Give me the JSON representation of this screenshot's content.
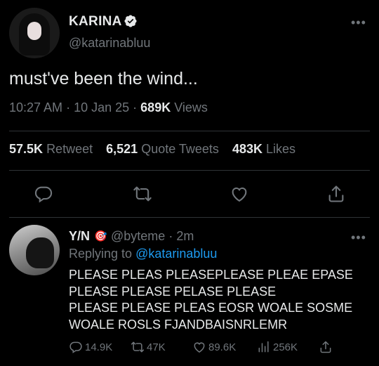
{
  "tweet": {
    "display_name": "KARINA",
    "handle": "@katarinabluu",
    "text": "must've been the wind...",
    "time": "10:27 AM",
    "date": "10 Jan 25",
    "views_count": "689K",
    "views_label": "Views",
    "retweets_count": "57.5K",
    "retweets_label": "Retweet",
    "quotes_count": "6,521",
    "quotes_label": "Quote Tweets",
    "likes_count": "483K",
    "likes_label": "Likes"
  },
  "reply": {
    "display_name": "Y/N",
    "emoji": "🎯",
    "handle": "@byteme",
    "time": "2m",
    "replying_prefix": "Replying to",
    "replying_handle": "@katarinabluu",
    "lines": [
      "PLEASE PLEAS PLEASEPLEASE PLEAE EPASE",
      "PLEASE PLEASE PELASE PLEASE",
      "PLEASE PLEASE PLEAS EOSR WOALE SOSME",
      "WOALE ROSLS FJANDBAISNRLEMR"
    ],
    "replies_count": "14.9K",
    "retweets_count": "47K",
    "likes_count": "89.6K",
    "views_count": "256K"
  },
  "colors": {
    "background": "#000000",
    "text_primary": "#e7e9ea",
    "text_secondary": "#71767b",
    "link": "#1d9bf0",
    "divider": "#2f3336"
  },
  "icons": [
    "verified-badge-icon",
    "more-icon",
    "reply-icon",
    "retweet-icon",
    "like-icon",
    "share-icon",
    "views-icon"
  ]
}
